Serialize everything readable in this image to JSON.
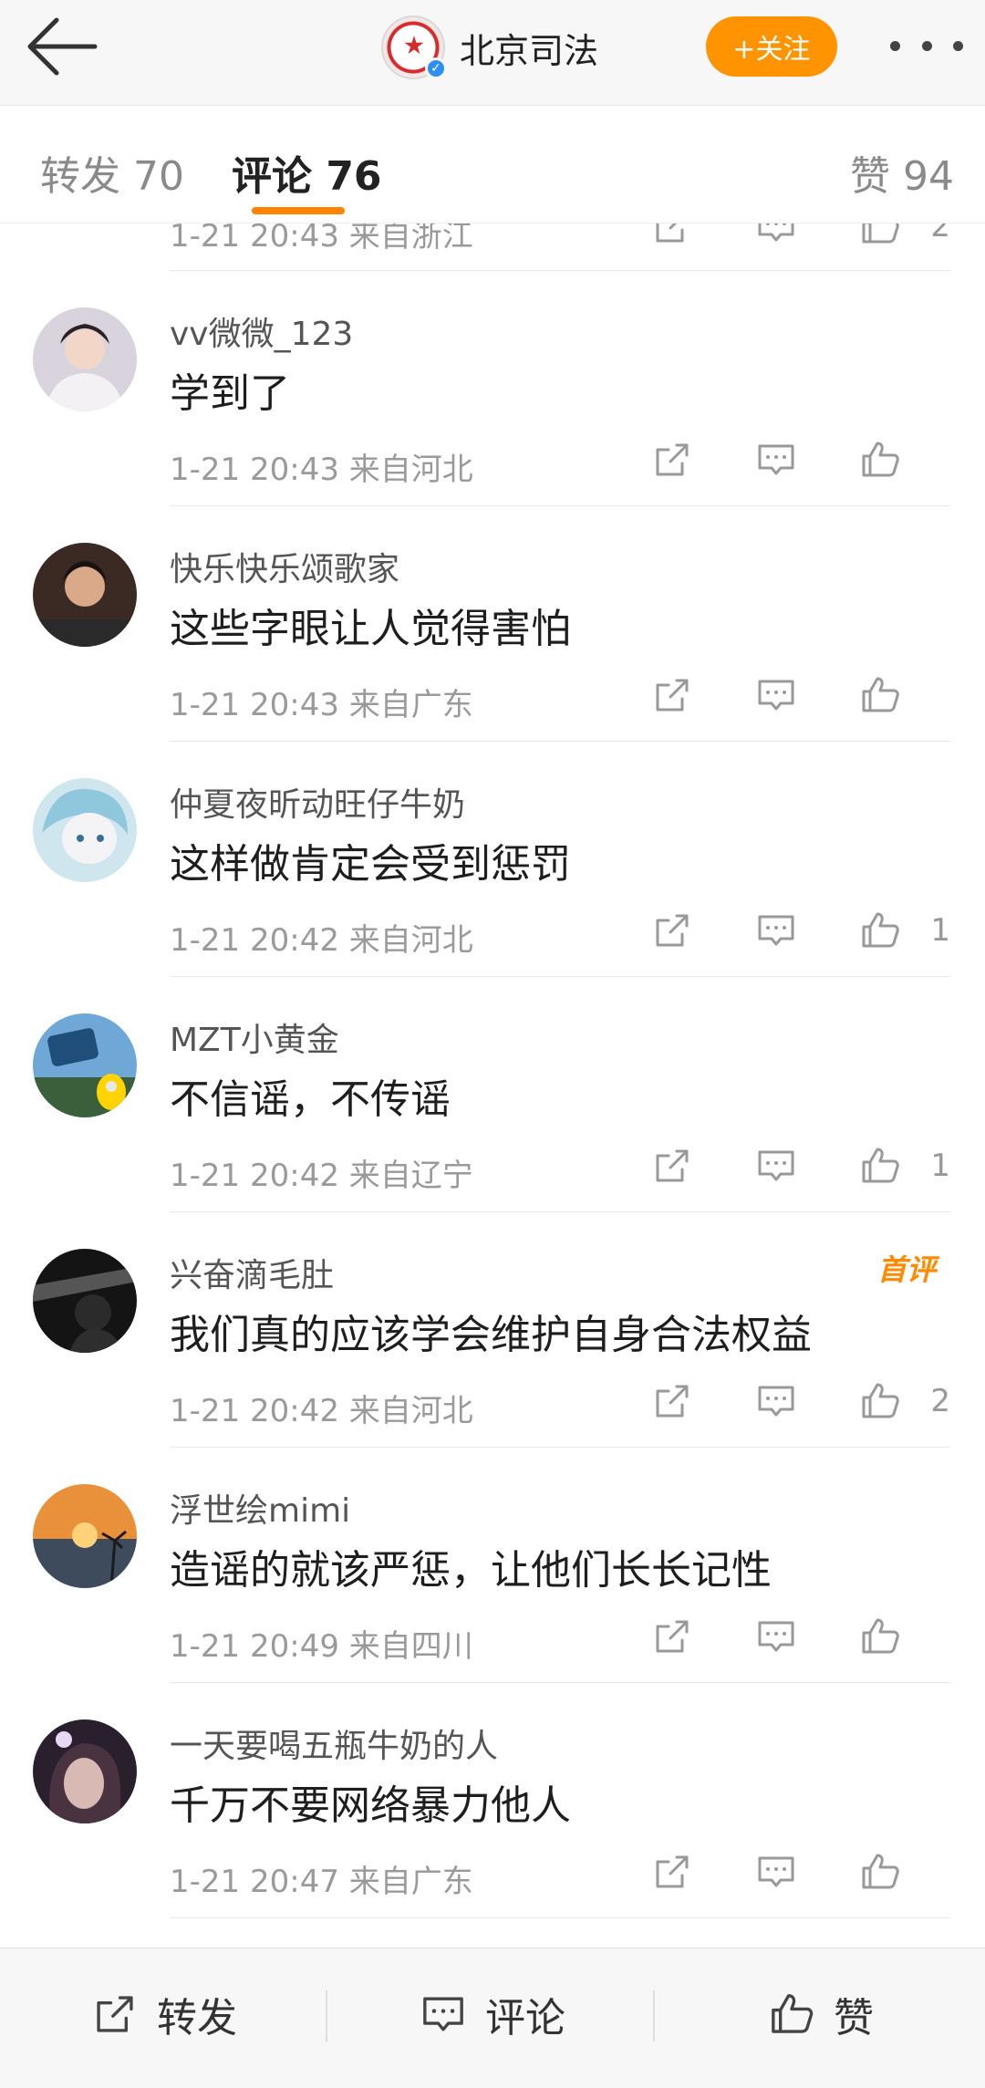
{
  "header": {
    "org_name": "北京司法",
    "follow_label": "+关注"
  },
  "tabs": [
    {
      "label": "转发 70"
    },
    {
      "label": "评论 76"
    },
    {
      "label": "赞 94"
    }
  ],
  "partial_comment": {
    "meta": "1-21 20:43 来自浙江",
    "like_count": "2"
  },
  "comments": [
    {
      "name": "vv微微_123",
      "text": "学到了",
      "time": "1-21 20:43",
      "source": "来自河北",
      "likes": ""
    },
    {
      "name": "快乐快乐颂歌家",
      "text": "这些字眼让人觉得害怕",
      "time": "1-21 20:43",
      "source": "来自广东",
      "likes": ""
    },
    {
      "name": "仲夏夜昕动旺仔牛奶",
      "text": "这样做肯定会受到惩罚",
      "time": "1-21 20:42",
      "source": "来自河北",
      "likes": "1"
    },
    {
      "name": "MZT小黄金",
      "text": "不信谣，不传谣",
      "time": "1-21 20:42",
      "source": "来自辽宁",
      "likes": "1"
    },
    {
      "name": "兴奋滴毛肚",
      "text": "我们真的应该学会维护自身合法权益",
      "time": "1-21 20:42",
      "source": "来自河北",
      "likes": "2",
      "badge": "首评"
    },
    {
      "name": "浮世绘mimi",
      "text": "造谣的就该严惩，让他们长长记性",
      "time": "1-21 20:49",
      "source": "来自四川",
      "likes": ""
    },
    {
      "name": "一天要喝五瓶牛奶的人",
      "text": "千万不要网络暴力他人",
      "time": "1-21 20:47",
      "source": "来自广东",
      "likes": ""
    }
  ],
  "bottom": {
    "repost": "转发",
    "comment": "评论",
    "like": "赞"
  },
  "colors": {
    "accent": "#ff8200",
    "follow_bg": "#ff9300"
  }
}
